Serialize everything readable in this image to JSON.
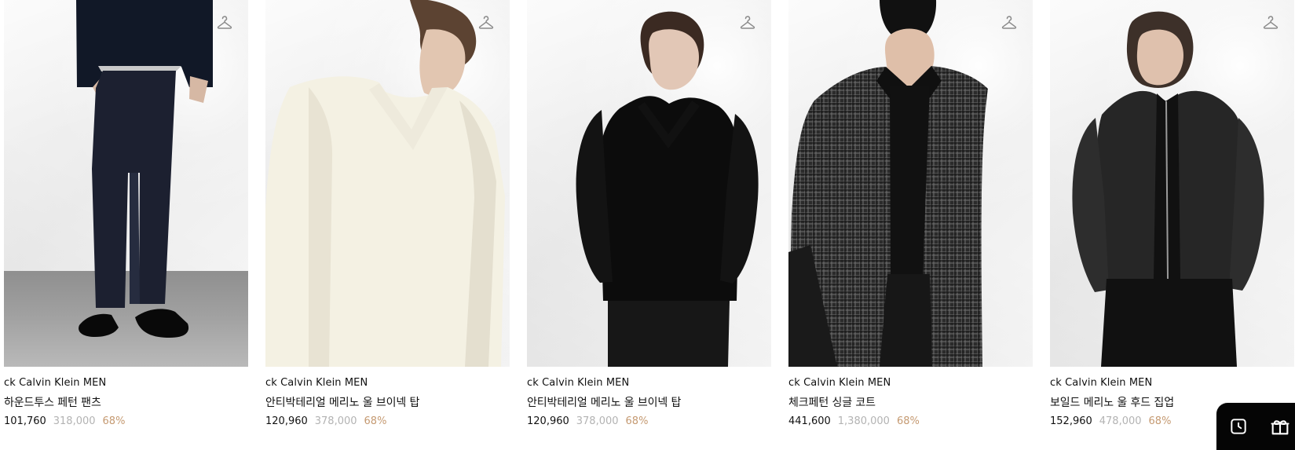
{
  "products": [
    {
      "brand": "ck Calvin Klein MEN",
      "name": "하운드투스 페턴 팬츠",
      "sale_price": "101,760",
      "original_price": "318,000",
      "discount": "68%",
      "icon": "hanger-icon",
      "image_name": "product-image-houndstooth-pants"
    },
    {
      "brand": "ck Calvin Klein MEN",
      "name": "안티박테리얼 메리노 울 브이넥 탑",
      "sale_price": "120,960",
      "original_price": "378,000",
      "discount": "68%",
      "icon": "hanger-icon",
      "image_name": "product-image-ivory-vneck"
    },
    {
      "brand": "ck Calvin Klein MEN",
      "name": "안티박테리얼 메리노 울 브이넥 탑",
      "sale_price": "120,960",
      "original_price": "378,000",
      "discount": "68%",
      "icon": "hanger-icon",
      "image_name": "product-image-black-vneck"
    },
    {
      "brand": "ck Calvin Klein MEN",
      "name": "체크페턴 싱글 코트",
      "sale_price": "441,600",
      "original_price": "1,380,000",
      "discount": "68%",
      "icon": "hanger-icon",
      "image_name": "product-image-check-coat"
    },
    {
      "brand": "ck Calvin Klein MEN",
      "name": "보일드 메리노 울 후드 집업",
      "sale_price": "152,960",
      "original_price": "478,000",
      "discount": "68%",
      "icon": "hanger-icon",
      "image_name": "product-image-hood-zipup"
    }
  ],
  "floating_actions": {
    "left_icon": "clock-icon",
    "right_icon": "gift-icon"
  },
  "colors": {
    "text": "#111111",
    "original_price": "#b3b3b3",
    "discount": "#c59a72",
    "floating_bg": "#050505"
  }
}
